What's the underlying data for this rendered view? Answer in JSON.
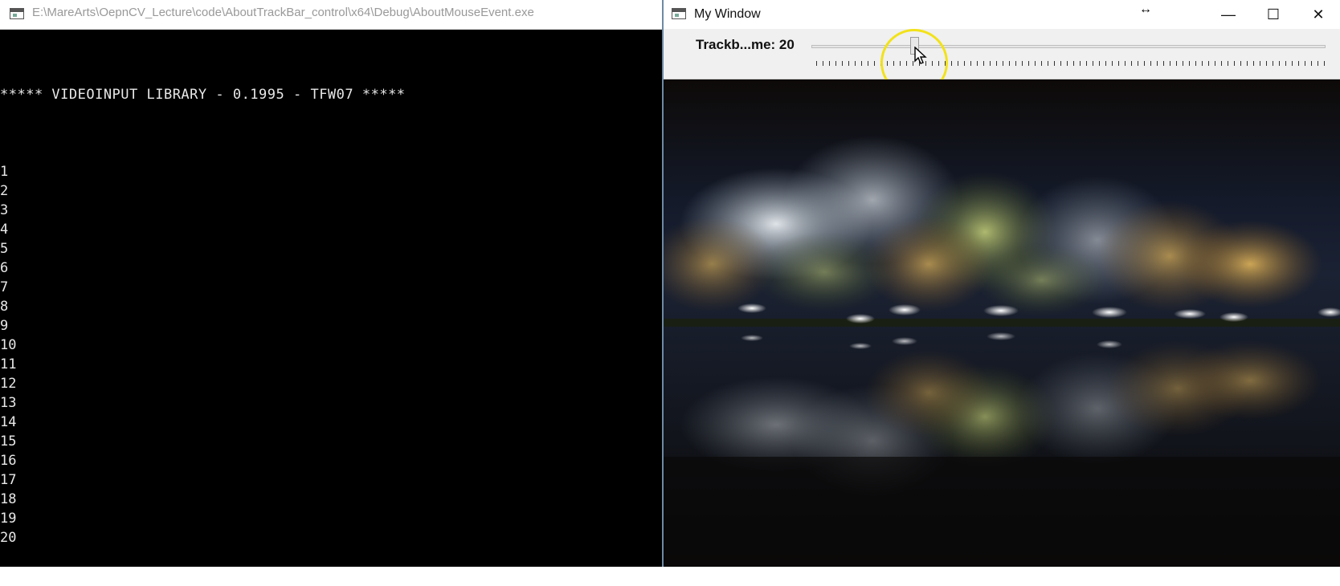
{
  "console": {
    "title": "E:\\MareArts\\OepnCV_Lecture\\code\\AboutTrackBar_control\\x64\\Debug\\AboutMouseEvent.exe",
    "banner": "***** VIDEOINPUT LIBRARY - 0.1995 - TFW07 *****",
    "lines": [
      "1",
      "2",
      "3",
      "4",
      "5",
      "6",
      "7",
      "8",
      "9",
      "10",
      "11",
      "12",
      "13",
      "14",
      "15",
      "16",
      "17",
      "18",
      "19",
      "20"
    ]
  },
  "cv_window": {
    "title": "My Window",
    "minimize_glyph": "—",
    "maximize_glyph": "☐",
    "close_glyph": "✕",
    "resize_cursor_glyph": "↔",
    "trackbar": {
      "label": "Trackb...me: 20",
      "value": 20,
      "max": 100
    },
    "image": {
      "description_icon": "night-lake-photo"
    }
  },
  "colors": {
    "console_bg": "#000000",
    "highlight": "#f2e21a"
  }
}
